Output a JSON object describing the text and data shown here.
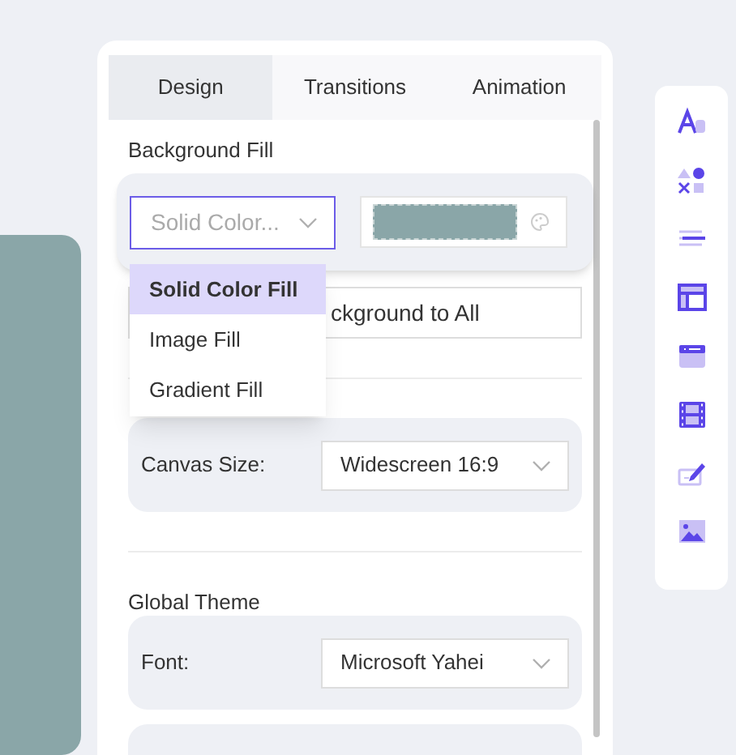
{
  "tabs": [
    {
      "label": "Design",
      "selected": true
    },
    {
      "label": "Transitions",
      "selected": false
    },
    {
      "label": "Animation",
      "selected": false
    }
  ],
  "background_fill": {
    "title": "Background Fill",
    "fill_type": {
      "value": "Solid Color...",
      "expanded": true,
      "options": [
        {
          "label": "Solid Color Fill",
          "selected": true
        },
        {
          "label": "Image Fill",
          "selected": false
        },
        {
          "label": "Gradient Fill",
          "selected": false
        }
      ]
    },
    "apply_button": "ckground to All"
  },
  "canvas_size": {
    "label": "Canvas Size:",
    "value": "Widescreen 16:9"
  },
  "global_theme": {
    "title": "Global Theme",
    "font": {
      "label": "Font:",
      "value": "Microsoft Yahei"
    }
  }
}
